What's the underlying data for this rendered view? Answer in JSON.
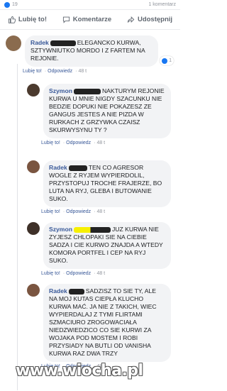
{
  "topbar": {
    "count": "19",
    "comments": "1 komentarz"
  },
  "actions": {
    "like": "Lubię to!",
    "comment": "Komentarze",
    "share": "Udostępnij"
  },
  "comments": [
    {
      "author": "Radek",
      "text": "ELEGANCKO KURWA, SZTYWNIUTKO MORDO I Z FARTEM NA REJONIE.",
      "meta": {
        "like": "Lubię to!",
        "reply": "Odpowiedz",
        "time": "48 t"
      },
      "likes": "1"
    },
    {
      "author": "Szymon",
      "text": "NAKTURYM REJONIE KURWA U MNIE NIGDY SZACUNKU NIE BEDZIE DOPUKI NIE POKAZESZ ZE GANGUS JESTES A NIE PIZDA W RURKACH Z GRZYWKA CZAISZ SKURWYSYNU TY ?",
      "meta": {
        "like": "Lubię to!",
        "reply": "Odpowiedz",
        "time": "48 t"
      }
    },
    {
      "author": "Radek",
      "text": "TEN CO AGRESOR WOGLE Z RYJEM WYPIERDOLIL, PRZYSTOPUJ TROCHE FRAJERZE, BO LUTA NA RYJ, GLEBA I BUTOWANIE SUKO.",
      "meta": {
        "like": "Lubię to!",
        "reply": "Odpowiedz",
        "time": "48 t"
      }
    },
    {
      "author": "Szymon",
      "text": "JUZ KURWA NIE ZYJESZ CHLOPAKI SIE NA CIEBIE SADZA I CIE KURWO ZNAJDA A WTEDY KOMORA PORTFEL I CEP NA RYJ SUKO.",
      "meta": {
        "like": "Lubię to!",
        "reply": "Odpowiedz",
        "time": "48 t"
      }
    },
    {
      "author": "Radek",
      "text": "SADZISZ TO SIE TY, ALE NA MOJ KUTAS CIEPŁA KLUCHO KURWA MAĆ. JA NIE Z TAKICH, WIEC WYPIERDALAJ Z TYMI FLIRTAMI SZMACIURO ZROGOWACIAŁA NIEDZWIEDZICO CO SIE KURWI ZA WOJAKA POD MOSTEM I ROBI PRZYSIADY NA BUTLI OD VANISHA KURWA RAZ DWA TRZY",
      "meta": {
        "like": "Lubię to!",
        "reply": "Odpowiedz",
        "time": "48 t"
      }
    }
  ],
  "watermark": "www.wiocha.pl",
  "colors": {
    "link": "#385898",
    "bubble": "#f2f3f5",
    "highlight": "#f7f000"
  }
}
